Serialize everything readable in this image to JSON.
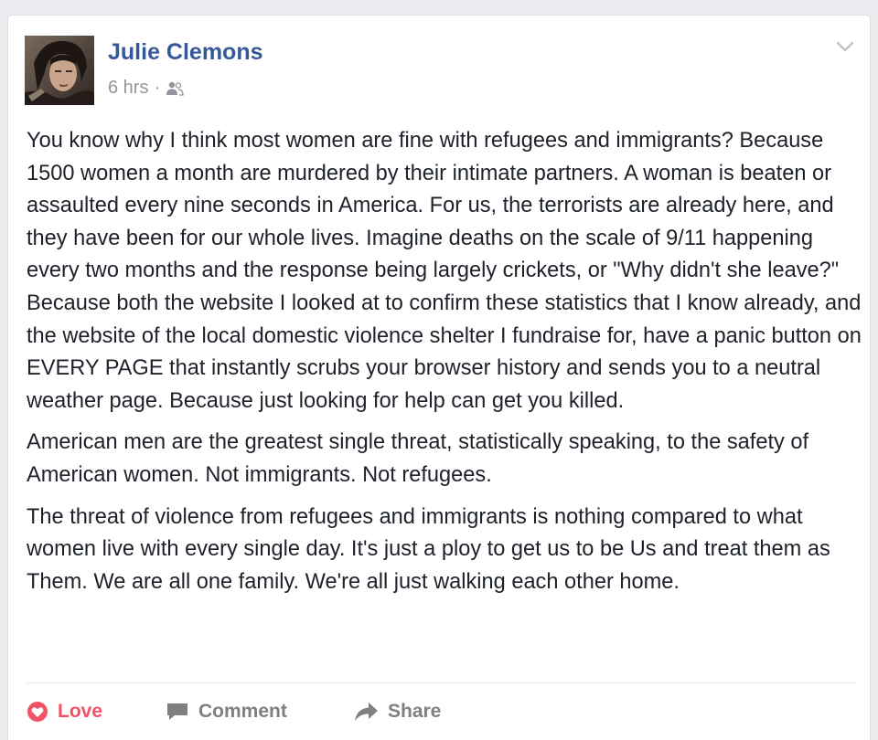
{
  "post": {
    "author": "Julie Clemons",
    "timestamp": "6 hrs",
    "separator": "·",
    "audience_icon": "friends-icon",
    "menu_icon": "chevron-down-icon",
    "paragraphs": [
      "You know why I think most women are fine with refugees and immigrants? Because 1500 women a month are murdered by their intimate partners. A woman is beaten or assaulted every nine seconds in America. For us, the terrorists are already here, and they have been for our whole lives. Imagine deaths on the scale of 9/11 happening every two months and the response being largely crickets, or \"Why didn't she leave?\" Because both the website I looked at to confirm these statistics that I know already, and the website of the local domestic violence shelter I fundraise for, have a panic button on EVERY PAGE that instantly scrubs your browser history and sends you to a neutral weather page. Because just looking for help can get you killed.",
      "American men are the greatest single threat, statistically speaking, to the safety of American women. Not immigrants. Not refugees.",
      "The threat of violence from refugees and immigrants is nothing compared to what women live with every single day. It's just a ploy to get us to be Us and treat them as Them. We are all one family. We're all just walking each other home."
    ]
  },
  "actions": {
    "love_label": "Love",
    "comment_label": "Comment",
    "share_label": "Share"
  },
  "colors": {
    "author_link": "#365899",
    "love_active": "#f25268",
    "action_gray": "#7f7f7f",
    "meta_gray": "#90949c",
    "body_text": "#1d2129"
  }
}
